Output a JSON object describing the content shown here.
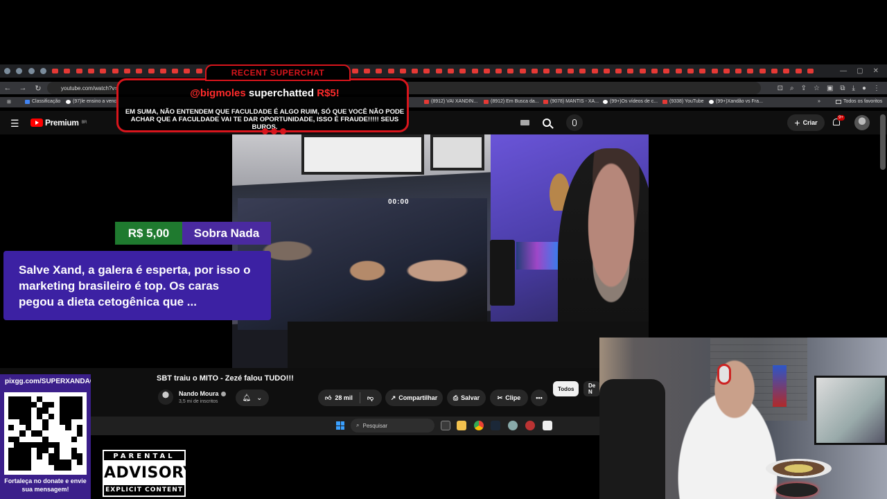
{
  "browser": {
    "url": "youtube.com/watch?v=",
    "bookmarks": [
      {
        "label": "Classificação"
      },
      {
        "label": "(97)le ensino a venc"
      },
      {
        "label": "(8912) VAI XANDIN..."
      },
      {
        "label": "(8912) Em Busca da..."
      },
      {
        "label": "(9078) MANTIS - XA..."
      },
      {
        "label": "(99+)Os vídeos de c..."
      },
      {
        "label": "(9338) YouTube"
      },
      {
        "label": "(99+)Xandão vs Fra..."
      }
    ],
    "favorites_label": "Todos os favoritos"
  },
  "youtube": {
    "logo_text": "Premium",
    "region": "BR",
    "create_label": "Criar",
    "notif_badge": "9+",
    "video_clock": "00:00",
    "video_title": "SBT traiu o MITO - Zezé falou TUDO!!!",
    "channel_name": "Nando Moura",
    "subscribers": "3,5 mi de inscritos",
    "likes": "28 mil",
    "share_label": "Compartilhar",
    "save_label": "Salvar",
    "clip_label": "Clipe",
    "chip_all": "Todos",
    "chip_other": "De N"
  },
  "taskbar": {
    "search_placeholder": "Pesquisar"
  },
  "superchat": {
    "tab_label": "RECENT SUPERCHAT",
    "username": "@bigmoles",
    "action": "superchatted",
    "amount": "R$5!",
    "message": "EM SUMA, NÃO ENTENDEM QUE FACULDADE É ALGO RUIM, SÓ QUE VOCÊ NÃO PODE ACHAR QUE A FACULDADE VAI TE DAR OPORTUNIDADE, ISSO É FRAUDE!!!!! SEUS BUROS."
  },
  "donation": {
    "amount": "R$ 5,00",
    "donor": "Sobra Nada",
    "message": "Salve Xand, a galera é esperta, por isso o marketing brasileiro é top. Os caras pegou a dieta cetogênica que ..."
  },
  "pix": {
    "url": "pixgg.com/SUPERXANDAO",
    "cta": "Fortaleça no donate e envie sua mensagem!"
  },
  "advisory": {
    "top": "PARENTAL",
    "middle": "ADVISORY",
    "bottom": "EXPLICIT CONTENT"
  },
  "colors": {
    "superchat_red": "#d8151c",
    "donation_green": "#1f7a2f",
    "donation_purple": "#3c21a3",
    "youtube_red": "#ff0000"
  }
}
